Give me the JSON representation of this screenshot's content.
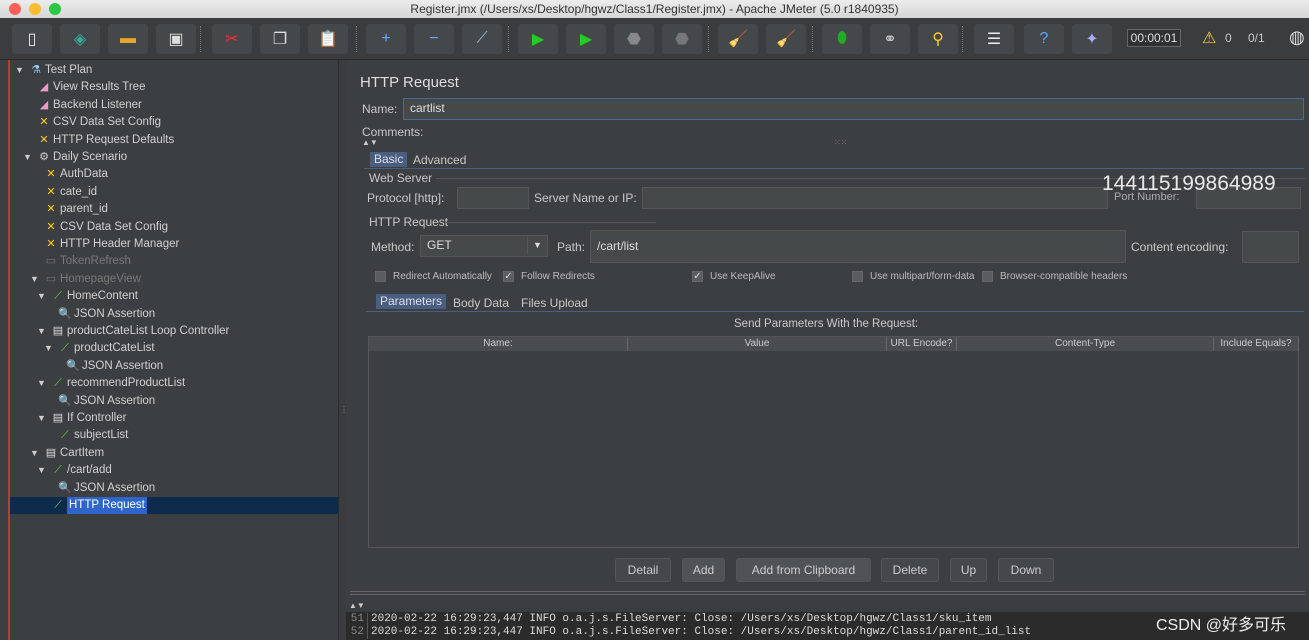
{
  "window": {
    "title": "Register.jmx (/Users/xs/Desktop/hgwz/Class1/Register.jmx) - Apache JMeter (5.0 r1840935)"
  },
  "toolbar": {
    "buttons": [
      {
        "name": "new",
        "icon": "new-file-icon",
        "glyph": "▯",
        "color": "#eee"
      },
      {
        "name": "templates",
        "icon": "templates-icon",
        "glyph": "◈",
        "color": "#3a9"
      },
      {
        "name": "open",
        "icon": "open-folder-icon",
        "glyph": "▬",
        "color": "#e5a829"
      },
      {
        "name": "save",
        "icon": "save-icon",
        "glyph": "▣",
        "color": "#ddd"
      },
      {
        "name": "cut",
        "icon": "cut-icon",
        "glyph": "✂",
        "color": "#e33"
      },
      {
        "name": "copy",
        "icon": "copy-icon",
        "glyph": "❐",
        "color": "#ddd"
      },
      {
        "name": "paste",
        "icon": "paste-icon",
        "glyph": "📋",
        "color": "#d9a"
      },
      {
        "name": "expand",
        "icon": "plus-icon",
        "glyph": "+",
        "color": "#6af"
      },
      {
        "name": "collapse",
        "icon": "minus-icon",
        "glyph": "−",
        "color": "#6af"
      },
      {
        "name": "toggle",
        "icon": "toggle-icon",
        "glyph": "⟋",
        "color": "#9bd"
      },
      {
        "name": "start",
        "icon": "play-icon",
        "glyph": "▶",
        "color": "#2c2"
      },
      {
        "name": "start-no-pauses",
        "icon": "play-no-timers-icon",
        "glyph": "▶",
        "color": "#2c2"
      },
      {
        "name": "stop",
        "icon": "stop-icon",
        "glyph": "⬣",
        "color": "#888"
      },
      {
        "name": "shutdown",
        "icon": "shutdown-icon",
        "glyph": "⬣",
        "color": "#777"
      },
      {
        "name": "clear",
        "icon": "clear-icon",
        "glyph": "🧹",
        "color": "#ca8"
      },
      {
        "name": "clear-all",
        "icon": "clear-all-icon",
        "glyph": "🧹",
        "color": "#ca8"
      },
      {
        "name": "search",
        "icon": "bug-icon",
        "glyph": "⬮",
        "color": "#2a2"
      },
      {
        "name": "find",
        "icon": "binoculars-icon",
        "glyph": "⚭",
        "color": "#ccc"
      },
      {
        "name": "reset-search",
        "icon": "broom-icon",
        "glyph": "⚲",
        "color": "#fc2"
      },
      {
        "name": "function-helper",
        "icon": "list-icon",
        "glyph": "☰",
        "color": "#eee"
      },
      {
        "name": "help",
        "icon": "help-icon",
        "glyph": "?",
        "color": "#5af"
      },
      {
        "name": "remote",
        "icon": "remote-icon",
        "glyph": "✦",
        "color": "#aaf"
      }
    ],
    "timer": "00:00:01",
    "warnings": "0",
    "threads": "0/1"
  },
  "tree": [
    {
      "label": "Test Plan",
      "level": 0,
      "arrow": true,
      "icon": "test-plan-icon",
      "glyph": "⚗",
      "color": "#9cf"
    },
    {
      "label": "View Results Tree",
      "level": 1,
      "icon": "listener-icon",
      "glyph": "◢",
      "color": "#e9c"
    },
    {
      "label": "Backend Listener",
      "level": 1,
      "icon": "listener-icon",
      "glyph": "◢",
      "color": "#e9c"
    },
    {
      "label": "CSV Data Set Config",
      "level": 1,
      "icon": "config-icon",
      "glyph": "✕",
      "color": "#fc2"
    },
    {
      "label": "HTTP Request Defaults",
      "level": 1,
      "icon": "config-icon",
      "glyph": "✕",
      "color": "#fc2"
    },
    {
      "label": "Daily Scenario",
      "level": 1,
      "arrow": true,
      "icon": "thread-group-icon",
      "glyph": "⚙",
      "color": "#ccc"
    },
    {
      "label": "AuthData",
      "level": 2,
      "icon": "config-icon",
      "glyph": "✕",
      "color": "#fc2"
    },
    {
      "label": "cate_id",
      "level": 2,
      "icon": "config-icon",
      "glyph": "✕",
      "color": "#fc2"
    },
    {
      "label": "parent_id",
      "level": 2,
      "icon": "config-icon",
      "glyph": "✕",
      "color": "#fc2"
    },
    {
      "label": "CSV Data Set Config",
      "level": 2,
      "icon": "config-icon",
      "glyph": "✕",
      "color": "#fc2"
    },
    {
      "label": "HTTP Header Manager",
      "level": 2,
      "icon": "config-icon",
      "glyph": "✕",
      "color": "#fc2"
    },
    {
      "label": "TokenRefresh",
      "level": 2,
      "disabled": true,
      "icon": "controller-icon",
      "glyph": "▭",
      "color": "#777"
    },
    {
      "label": "HomepageView",
      "level": 2,
      "arrow": true,
      "disabled": true,
      "icon": "controller-icon",
      "glyph": "▭",
      "color": "#777"
    },
    {
      "label": "HomeContent",
      "level": 3,
      "arrow": true,
      "icon": "sampler-icon",
      "glyph": "⟋",
      "color": "#7c5"
    },
    {
      "label": "JSON Assertion",
      "level": 4,
      "icon": "assertion-icon",
      "glyph": "🔍",
      "color": "#9cf"
    },
    {
      "label": "productCateList Loop Controller",
      "level": 3,
      "arrow": true,
      "icon": "controller-icon",
      "glyph": "▤",
      "color": "#ddd"
    },
    {
      "label": "productCateList",
      "level": 4,
      "arrow": true,
      "icon": "sampler-icon",
      "glyph": "⟋",
      "color": "#7c5"
    },
    {
      "label": "JSON Assertion",
      "level": 5,
      "icon": "assertion-icon",
      "glyph": "🔍",
      "color": "#9cf"
    },
    {
      "label": "recommendProductList",
      "level": 3,
      "arrow": true,
      "icon": "sampler-icon",
      "glyph": "⟋",
      "color": "#7c5"
    },
    {
      "label": "JSON Assertion",
      "level": 4,
      "icon": "assertion-icon",
      "glyph": "🔍",
      "color": "#9cf"
    },
    {
      "label": "If Controller",
      "level": 3,
      "arrow": true,
      "icon": "controller-icon",
      "glyph": "▤",
      "color": "#ddd"
    },
    {
      "label": "subjectList",
      "level": 4,
      "icon": "sampler-icon",
      "glyph": "⟋",
      "color": "#7c5"
    },
    {
      "label": "CartItem",
      "level": 2,
      "arrow": true,
      "icon": "controller-icon",
      "glyph": "▤",
      "color": "#ddd"
    },
    {
      "label": "/cart/add",
      "level": 3,
      "arrow": true,
      "icon": "sampler-icon",
      "glyph": "⟋",
      "color": "#7c5"
    },
    {
      "label": "JSON Assertion",
      "level": 4,
      "icon": "assertion-icon",
      "glyph": "🔍",
      "color": "#9cf"
    },
    {
      "label": "HTTP Request",
      "level": 3,
      "selected": true,
      "icon": "sampler-icon",
      "glyph": "⟋",
      "color": "#7c5"
    }
  ],
  "panel": {
    "title": "HTTP Request",
    "name_label": "Name:",
    "name_value": "cartlist",
    "comments_label": "Comments:",
    "tabs": [
      "Basic",
      "Advanced"
    ],
    "web_server": {
      "title": "Web Server",
      "protocol_label": "Protocol [http]:",
      "protocol_value": "",
      "server_label": "Server Name or IP:",
      "server_value": "",
      "port_label": "Port Number:",
      "port_value": "",
      "overlay_number": "144115199864989"
    },
    "http_request": {
      "title": "HTTP Request",
      "method_label": "Method:",
      "method_value": "GET",
      "path_label": "Path:",
      "path_value": "/cart/list",
      "encoding_label": "Content encoding:",
      "encoding_value": ""
    },
    "checkboxes": [
      {
        "label": "Redirect Automatically",
        "checked": false
      },
      {
        "label": "Follow Redirects",
        "checked": true
      },
      {
        "label": "Use KeepAlive",
        "checked": true
      },
      {
        "label": "Use multipart/form-data",
        "checked": false
      },
      {
        "label": "Browser-compatible headers",
        "checked": false
      }
    ],
    "param_tabs": [
      "Parameters",
      "Body Data",
      "Files Upload"
    ],
    "table_title": "Send Parameters With the Request:",
    "columns": [
      "Name:",
      "Value",
      "URL Encode?",
      "Content-Type",
      "Include Equals?"
    ],
    "buttons": [
      "Detail",
      "Add",
      "Add from Clipboard",
      "Delete",
      "Up",
      "Down"
    ]
  },
  "log": [
    {
      "n": "51",
      "text": "2020-02-22 16:29:23,447 INFO o.a.j.s.FileServer: Close: /Users/xs/Desktop/hgwz/Class1/sku_item"
    },
    {
      "n": "52",
      "text": "2020-02-22 16:29:23,447 INFO o.a.j.s.FileServer: Close: /Users/xs/Desktop/hgwz/Class1/parent_id_list"
    }
  ],
  "watermark": "CSDN @好多可乐"
}
